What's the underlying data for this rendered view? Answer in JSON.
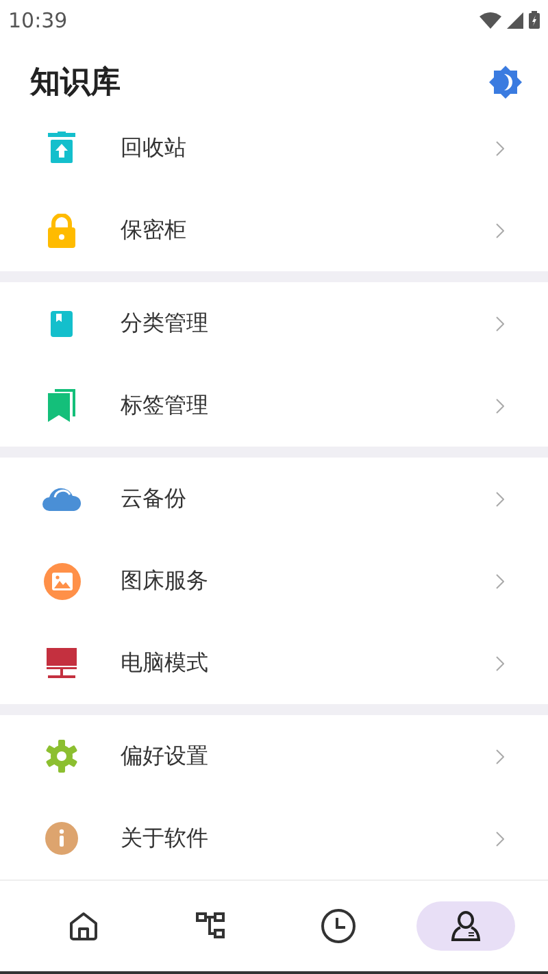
{
  "status_bar": {
    "time": "10:39"
  },
  "header": {
    "title": "知识库"
  },
  "sections": [
    {
      "items": [
        {
          "kind": "recycle",
          "label": "回收站"
        },
        {
          "kind": "lock",
          "label": "保密柜"
        }
      ]
    },
    {
      "items": [
        {
          "kind": "category",
          "label": "分类管理"
        },
        {
          "kind": "tag",
          "label": "标签管理"
        }
      ]
    },
    {
      "items": [
        {
          "kind": "cloud",
          "label": "云备份"
        },
        {
          "kind": "image",
          "label": "图床服务"
        },
        {
          "kind": "desktop",
          "label": "电脑模式"
        }
      ]
    },
    {
      "items": [
        {
          "kind": "settings",
          "label": "偏好设置"
        },
        {
          "kind": "info",
          "label": "关于软件"
        }
      ]
    }
  ],
  "bottom_nav": [
    {
      "kind": "home",
      "selected": false
    },
    {
      "kind": "tree",
      "selected": false
    },
    {
      "kind": "clock",
      "selected": false
    },
    {
      "kind": "profile",
      "selected": true
    }
  ]
}
